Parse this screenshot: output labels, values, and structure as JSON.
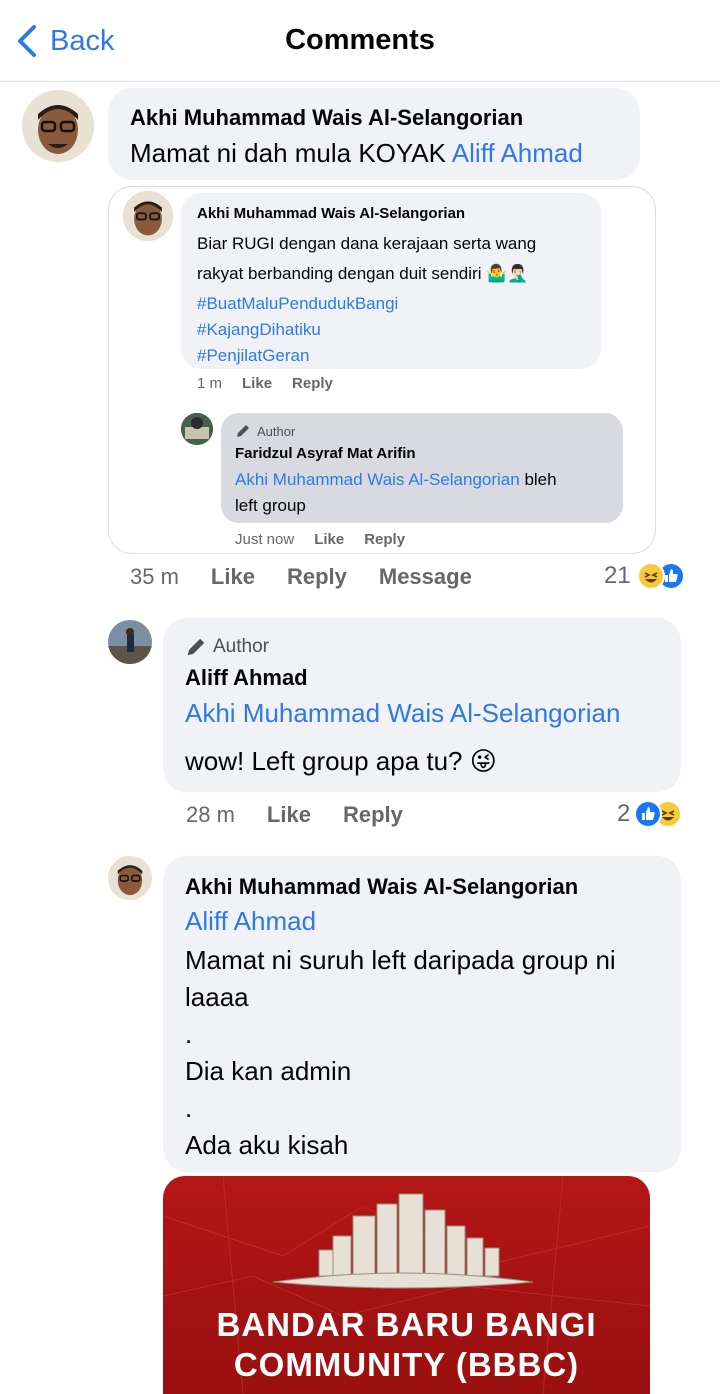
{
  "header": {
    "back_label": "Back",
    "title": "Comments"
  },
  "comment1": {
    "author": "Akhi Muhammad Wais Al-Selangorian",
    "text": "Mamat ni dah mula KOYAK",
    "mention": "Aliff Ahmad",
    "shared": {
      "author": "Akhi Muhammad Wais Al-Selangorian",
      "line1": "Biar RUGI dengan dana kerajaan serta wang",
      "line2": "rakyat berbanding dengan duit sendiri 🤷‍♂️🤦🏻‍♂️",
      "hashtags": [
        "#BuatMaluPendudukBangi",
        "#KajangDihatiku",
        "#PenjilatGeran"
      ],
      "time": "1 m",
      "like": "Like",
      "reply": "Reply",
      "nested": {
        "tag": "Author",
        "author": "Faridzul Asyraf Mat Arifin",
        "mention": "Akhi Muhammad Wais Al-Selangorian",
        "text_after": " bleh",
        "text_line2": "left group",
        "time": "Just now",
        "like": "Like",
        "reply": "Reply"
      }
    },
    "time": "35 m",
    "like": "Like",
    "reply": "Reply",
    "message": "Message",
    "reaction_count": "21"
  },
  "comment2": {
    "tag": "Author",
    "author": "Aliff Ahmad",
    "mention": "Akhi Muhammad Wais Al-Selangorian",
    "text": "wow! Left group apa tu? 😜",
    "time": "28 m",
    "like": "Like",
    "reply": "Reply",
    "reaction_count": "2"
  },
  "comment3": {
    "author": "Akhi Muhammad Wais Al-Selangorian",
    "mention": "Aliff Ahmad",
    "line1": "Mamat ni suruh left daripada group ni",
    "line2": "laaaa",
    "dot1": ".",
    "line3": "Dia kan admin",
    "dot2": ".",
    "line4": "Ada aku kisah",
    "banner": {
      "line1": "BANDAR BARU BANGI",
      "line2": "COMMUNITY (BBBC)"
    }
  },
  "colors": {
    "accent": "#2f79e6",
    "bubble": "#f0f2f5",
    "bubble_dark": "#d9dadf",
    "banner": "#a31212",
    "secondary_text": "#65676b"
  },
  "icons": [
    "chevron-left-icon",
    "pencil-icon",
    "haha-reaction-icon",
    "like-reaction-icon"
  ]
}
